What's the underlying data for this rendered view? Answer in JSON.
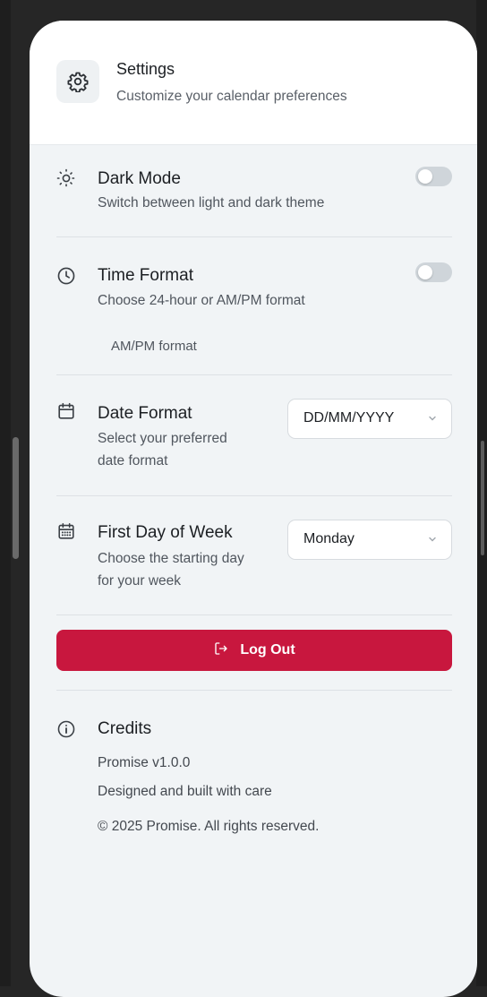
{
  "header": {
    "title": "Settings",
    "subtitle": "Customize your calendar preferences"
  },
  "dark_mode": {
    "label": "Dark Mode",
    "description": "Switch between light and dark theme",
    "enabled": false
  },
  "time_format": {
    "label": "Time Format",
    "description": "Choose 24-hour or AM/PM format",
    "current": "AM/PM format",
    "enabled": false
  },
  "date_format": {
    "label": "Date Format",
    "description_line1": "Select your preferred",
    "description_line2": "date format",
    "selected": "DD/MM/YYYY"
  },
  "first_day": {
    "label": "First Day of Week",
    "description_line1": "Choose the starting day",
    "description_line2": "for your week",
    "selected": "Monday"
  },
  "logout": {
    "label": "Log Out"
  },
  "credits": {
    "title": "Credits",
    "version": "Promise v1.0.0",
    "tagline": "Designed and built with care",
    "copyright": "© 2025 Promise. All rights reserved."
  },
  "colors": {
    "accent": "#c8173e",
    "panel_bg": "#f1f4f6",
    "toggle_off": "#cfd5da"
  }
}
